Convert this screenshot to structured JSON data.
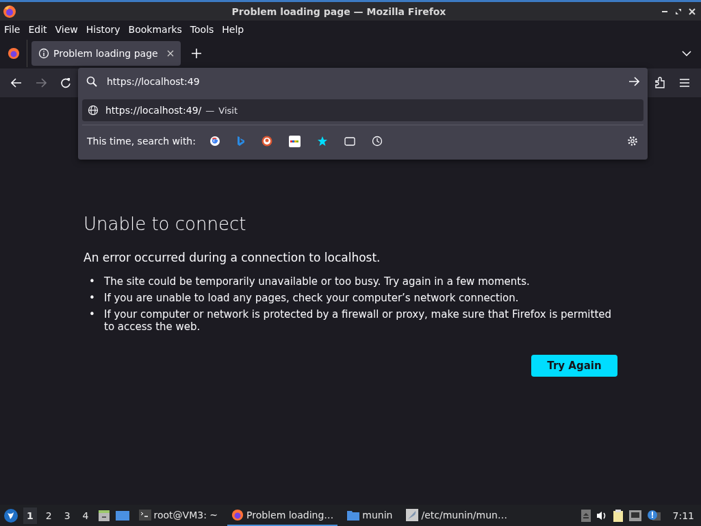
{
  "window": {
    "title": "Problem loading page — Mozilla Firefox"
  },
  "menu": [
    "File",
    "Edit",
    "View",
    "History",
    "Bookmarks",
    "Tools",
    "Help"
  ],
  "tabs": [
    {
      "label": "Problem loading page",
      "selected": true
    }
  ],
  "address_bar": {
    "value": "https://localhost:49"
  },
  "suggestions": [
    {
      "url": "https://localhost:49/",
      "separator": "—",
      "action": "Visit",
      "selected": true
    }
  ],
  "search_with": {
    "label": "This time, search with:",
    "engines": [
      {
        "kind": "google"
      },
      {
        "kind": "bing"
      },
      {
        "kind": "duckduckgo"
      },
      {
        "kind": "ebay"
      },
      {
        "kind": "bookmarks"
      },
      {
        "kind": "tabs"
      },
      {
        "kind": "history"
      }
    ]
  },
  "error_page": {
    "heading": "Unable to connect",
    "intro": "An error occurred during a connection to localhost.",
    "bullets": [
      "The site could be temporarily unavailable or too busy. Try again in a few moments.",
      "If you are unable to load any pages, check your computer’s network connection.",
      "If your computer or network is protected by a firewall or proxy, make sure that Firefox is permitted to access the web."
    ],
    "bullet_marker": "•",
    "button": "Try Again"
  },
  "taskbar": {
    "workspaces": [
      {
        "label": "1",
        "selected": true
      },
      {
        "label": "2",
        "selected": false
      },
      {
        "label": "3",
        "selected": false
      },
      {
        "label": "4",
        "selected": false
      }
    ],
    "tasks": [
      {
        "kind": "terminal",
        "label": "root@VM3: ~",
        "selected": false
      },
      {
        "kind": "firefox",
        "label": "Problem loading…",
        "selected": true
      },
      {
        "kind": "folder",
        "label": "munin",
        "selected": false
      },
      {
        "kind": "editor",
        "label": "/etc/munin/mun…",
        "selected": false
      }
    ],
    "clock": "7:11"
  }
}
